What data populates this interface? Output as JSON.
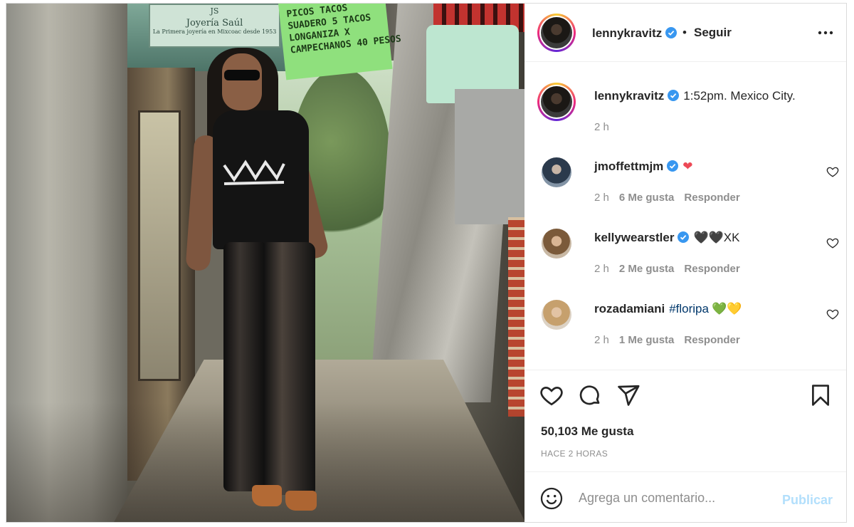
{
  "post": {
    "author": "lennykravitz",
    "follow_label": "Seguir",
    "separator": "•",
    "more_icon": "more-horizontal-icon"
  },
  "photo": {
    "sign_jewelry_line1": "JS",
    "sign_jewelry_line2": "Joyería Saúl",
    "sign_jewelry_line3": "La Primera joyería en Mixcoac desde 1953",
    "sign_tacos": "PICOS TACOS\nSUADERO 5 TACOS\nLONGANIZA X\nCAMPECHANOS 40 PESOS"
  },
  "caption": {
    "username": "lennykravitz",
    "text": "1:52pm. Mexico City.",
    "time": "2 h"
  },
  "comments": [
    {
      "username": "jmoffettmjm",
      "text": "❤",
      "time": "2 h",
      "likes": "6 Me gusta",
      "reply": "Responder"
    },
    {
      "username": "kellywearstler",
      "text": "🖤🖤XK",
      "time": "2 h",
      "likes": "2 Me gusta",
      "reply": "Responder"
    },
    {
      "username": "rozadamiani",
      "text_tag": "#floripa",
      "text": "💚💛",
      "time": "2 h",
      "likes": "1 Me gusta",
      "reply": "Responder"
    }
  ],
  "stats": {
    "likes": "50,103 Me gusta",
    "time_ago": "HACE 2 HORAS"
  },
  "composer": {
    "placeholder": "Agrega un comentario...",
    "publish": "Publicar"
  },
  "colors": {
    "verified": "#3897f0",
    "link": "#00376b",
    "publish_disabled": "#b2dffc"
  }
}
